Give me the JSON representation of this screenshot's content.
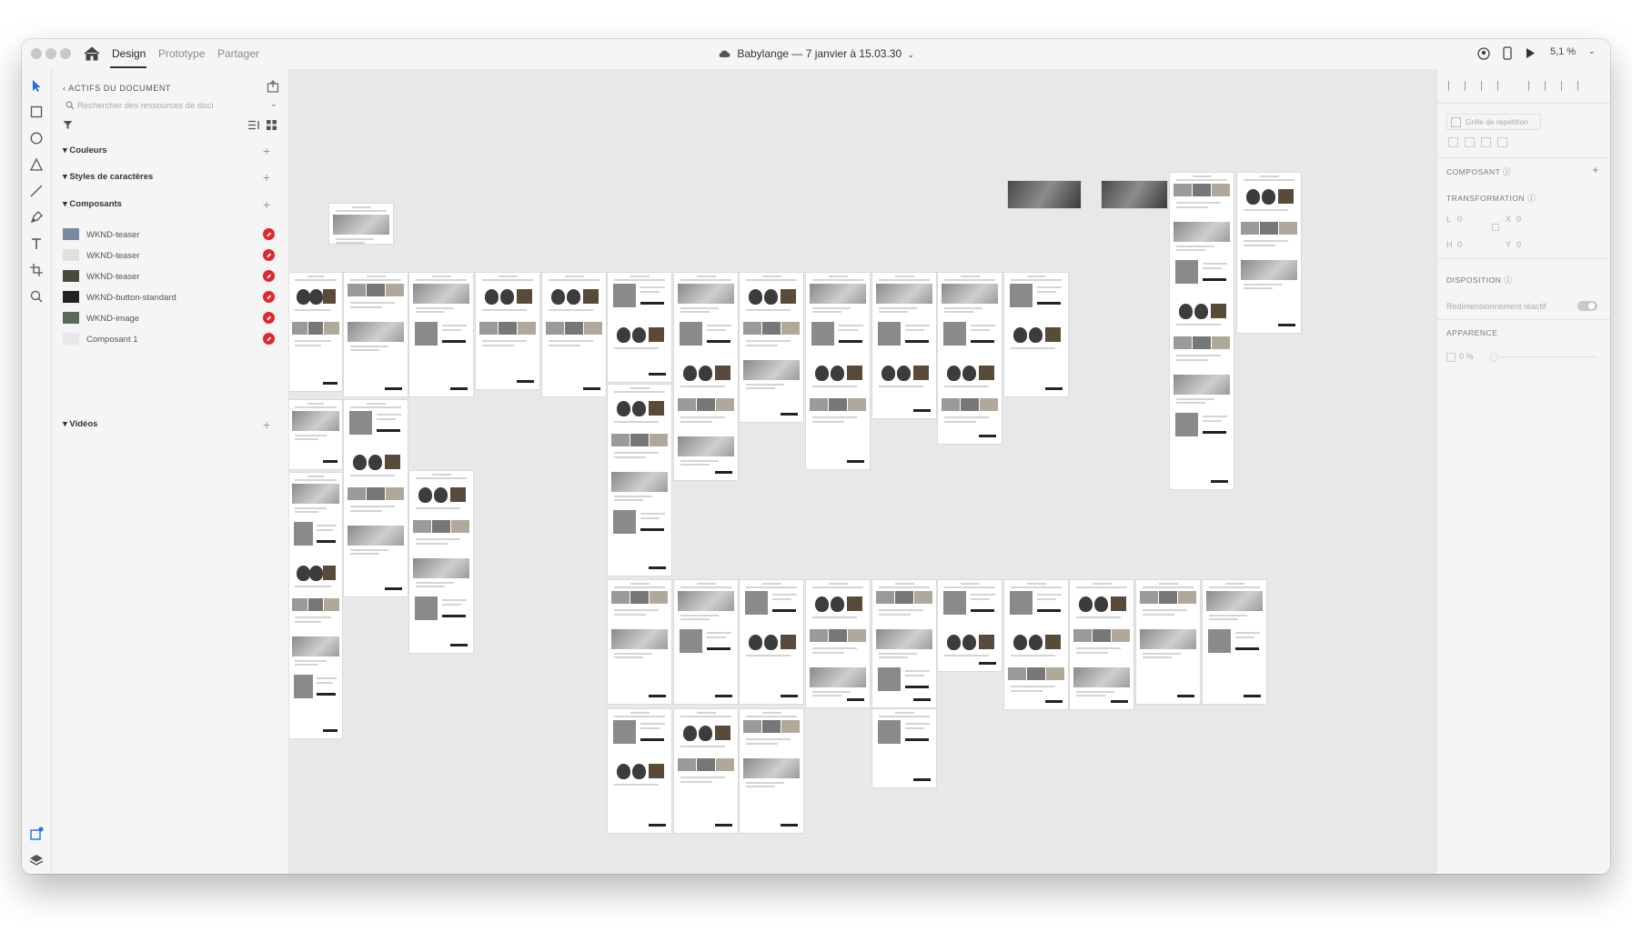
{
  "titlebar": {
    "tabs": [
      {
        "label": "Design",
        "active": true
      },
      {
        "label": "Prototype",
        "active": false
      },
      {
        "label": "Partager",
        "active": false
      }
    ],
    "document_title": "Babylange — 7 janvier à 15.03.30",
    "zoom": "5,1 %",
    "icons": [
      "home-icon",
      "cloud-icon",
      "user-icon",
      "device-preview-icon",
      "play-icon",
      "chevron-down-icon"
    ]
  },
  "tools": [
    "select-tool-icon",
    "rectangle-tool-icon",
    "ellipse-tool-icon",
    "polygon-tool-icon",
    "line-tool-icon",
    "pen-tool-icon",
    "text-tool-icon",
    "artboard-tool-icon",
    "zoom-tool-icon"
  ],
  "bottom_tools": [
    "document-assets-icon",
    "layers-icon",
    "plugins-icon"
  ],
  "assets": {
    "header": "ACTIFS DU DOCUMENT",
    "search_placeholder": "Rechercher des ressources de doci",
    "sections": {
      "colors": "Couleurs",
      "char_styles": "Styles de caractères",
      "components": "Composants",
      "videos": "Vidéos"
    },
    "components": [
      {
        "label": "WKND-teaser",
        "thumb": "#7a8aa0"
      },
      {
        "label": "WKND-teaser",
        "thumb": "#e0e0e0"
      },
      {
        "label": "WKND-teaser",
        "thumb": "#4a4a3a"
      },
      {
        "label": "WKND-button-standard",
        "thumb": "#222222"
      },
      {
        "label": "WKND-image",
        "thumb": "#5a6a5a"
      },
      {
        "label": "Composant 1",
        "thumb": "#e8e8e8"
      }
    ]
  },
  "props": {
    "repeat_grid": "Grille de répétition",
    "component_label": "COMPOSANT",
    "transform_label": "TRANSFORMATION",
    "w": "L",
    "w_val": "0",
    "x": "X",
    "x_val": "0",
    "h": "H",
    "h_val": "0",
    "y": "Y",
    "y_val": "0",
    "layout_label": "DISPOSITION",
    "responsive_resize": "Redimensionnement réactif",
    "appearance_label": "APPARENCE",
    "opacity": "0 %"
  },
  "colors": {
    "accent_red": "#e3262e",
    "canvas_bg": "#e8e8e8",
    "panel_bg": "#f5f5f5"
  }
}
